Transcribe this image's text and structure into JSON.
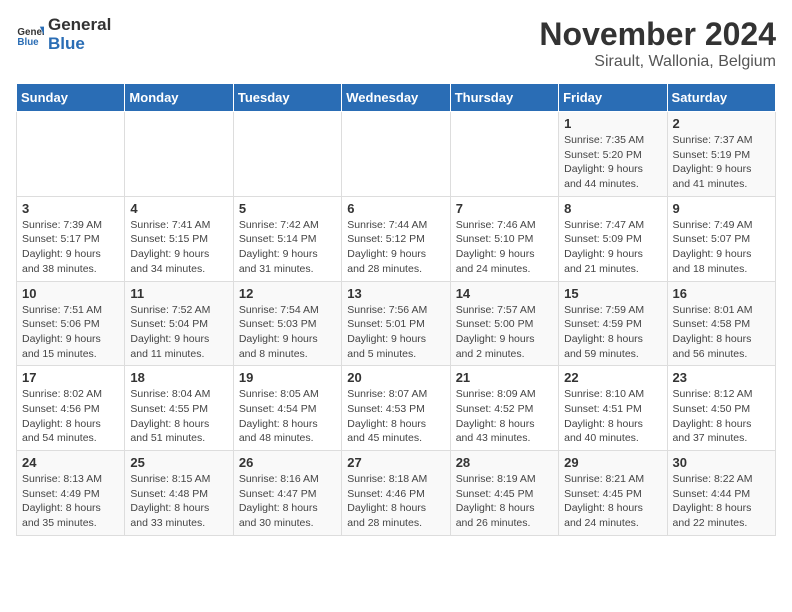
{
  "header": {
    "logo_general": "General",
    "logo_blue": "Blue",
    "month": "November 2024",
    "location": "Sirault, Wallonia, Belgium"
  },
  "days_of_week": [
    "Sunday",
    "Monday",
    "Tuesday",
    "Wednesday",
    "Thursday",
    "Friday",
    "Saturday"
  ],
  "weeks": [
    [
      {
        "day": "",
        "info": ""
      },
      {
        "day": "",
        "info": ""
      },
      {
        "day": "",
        "info": ""
      },
      {
        "day": "",
        "info": ""
      },
      {
        "day": "",
        "info": ""
      },
      {
        "day": "1",
        "info": "Sunrise: 7:35 AM\nSunset: 5:20 PM\nDaylight: 9 hours and 44 minutes."
      },
      {
        "day": "2",
        "info": "Sunrise: 7:37 AM\nSunset: 5:19 PM\nDaylight: 9 hours and 41 minutes."
      }
    ],
    [
      {
        "day": "3",
        "info": "Sunrise: 7:39 AM\nSunset: 5:17 PM\nDaylight: 9 hours and 38 minutes."
      },
      {
        "day": "4",
        "info": "Sunrise: 7:41 AM\nSunset: 5:15 PM\nDaylight: 9 hours and 34 minutes."
      },
      {
        "day": "5",
        "info": "Sunrise: 7:42 AM\nSunset: 5:14 PM\nDaylight: 9 hours and 31 minutes."
      },
      {
        "day": "6",
        "info": "Sunrise: 7:44 AM\nSunset: 5:12 PM\nDaylight: 9 hours and 28 minutes."
      },
      {
        "day": "7",
        "info": "Sunrise: 7:46 AM\nSunset: 5:10 PM\nDaylight: 9 hours and 24 minutes."
      },
      {
        "day": "8",
        "info": "Sunrise: 7:47 AM\nSunset: 5:09 PM\nDaylight: 9 hours and 21 minutes."
      },
      {
        "day": "9",
        "info": "Sunrise: 7:49 AM\nSunset: 5:07 PM\nDaylight: 9 hours and 18 minutes."
      }
    ],
    [
      {
        "day": "10",
        "info": "Sunrise: 7:51 AM\nSunset: 5:06 PM\nDaylight: 9 hours and 15 minutes."
      },
      {
        "day": "11",
        "info": "Sunrise: 7:52 AM\nSunset: 5:04 PM\nDaylight: 9 hours and 11 minutes."
      },
      {
        "day": "12",
        "info": "Sunrise: 7:54 AM\nSunset: 5:03 PM\nDaylight: 9 hours and 8 minutes."
      },
      {
        "day": "13",
        "info": "Sunrise: 7:56 AM\nSunset: 5:01 PM\nDaylight: 9 hours and 5 minutes."
      },
      {
        "day": "14",
        "info": "Sunrise: 7:57 AM\nSunset: 5:00 PM\nDaylight: 9 hours and 2 minutes."
      },
      {
        "day": "15",
        "info": "Sunrise: 7:59 AM\nSunset: 4:59 PM\nDaylight: 8 hours and 59 minutes."
      },
      {
        "day": "16",
        "info": "Sunrise: 8:01 AM\nSunset: 4:58 PM\nDaylight: 8 hours and 56 minutes."
      }
    ],
    [
      {
        "day": "17",
        "info": "Sunrise: 8:02 AM\nSunset: 4:56 PM\nDaylight: 8 hours and 54 minutes."
      },
      {
        "day": "18",
        "info": "Sunrise: 8:04 AM\nSunset: 4:55 PM\nDaylight: 8 hours and 51 minutes."
      },
      {
        "day": "19",
        "info": "Sunrise: 8:05 AM\nSunset: 4:54 PM\nDaylight: 8 hours and 48 minutes."
      },
      {
        "day": "20",
        "info": "Sunrise: 8:07 AM\nSunset: 4:53 PM\nDaylight: 8 hours and 45 minutes."
      },
      {
        "day": "21",
        "info": "Sunrise: 8:09 AM\nSunset: 4:52 PM\nDaylight: 8 hours and 43 minutes."
      },
      {
        "day": "22",
        "info": "Sunrise: 8:10 AM\nSunset: 4:51 PM\nDaylight: 8 hours and 40 minutes."
      },
      {
        "day": "23",
        "info": "Sunrise: 8:12 AM\nSunset: 4:50 PM\nDaylight: 8 hours and 37 minutes."
      }
    ],
    [
      {
        "day": "24",
        "info": "Sunrise: 8:13 AM\nSunset: 4:49 PM\nDaylight: 8 hours and 35 minutes."
      },
      {
        "day": "25",
        "info": "Sunrise: 8:15 AM\nSunset: 4:48 PM\nDaylight: 8 hours and 33 minutes."
      },
      {
        "day": "26",
        "info": "Sunrise: 8:16 AM\nSunset: 4:47 PM\nDaylight: 8 hours and 30 minutes."
      },
      {
        "day": "27",
        "info": "Sunrise: 8:18 AM\nSunset: 4:46 PM\nDaylight: 8 hours and 28 minutes."
      },
      {
        "day": "28",
        "info": "Sunrise: 8:19 AM\nSunset: 4:45 PM\nDaylight: 8 hours and 26 minutes."
      },
      {
        "day": "29",
        "info": "Sunrise: 8:21 AM\nSunset: 4:45 PM\nDaylight: 8 hours and 24 minutes."
      },
      {
        "day": "30",
        "info": "Sunrise: 8:22 AM\nSunset: 4:44 PM\nDaylight: 8 hours and 22 minutes."
      }
    ]
  ]
}
